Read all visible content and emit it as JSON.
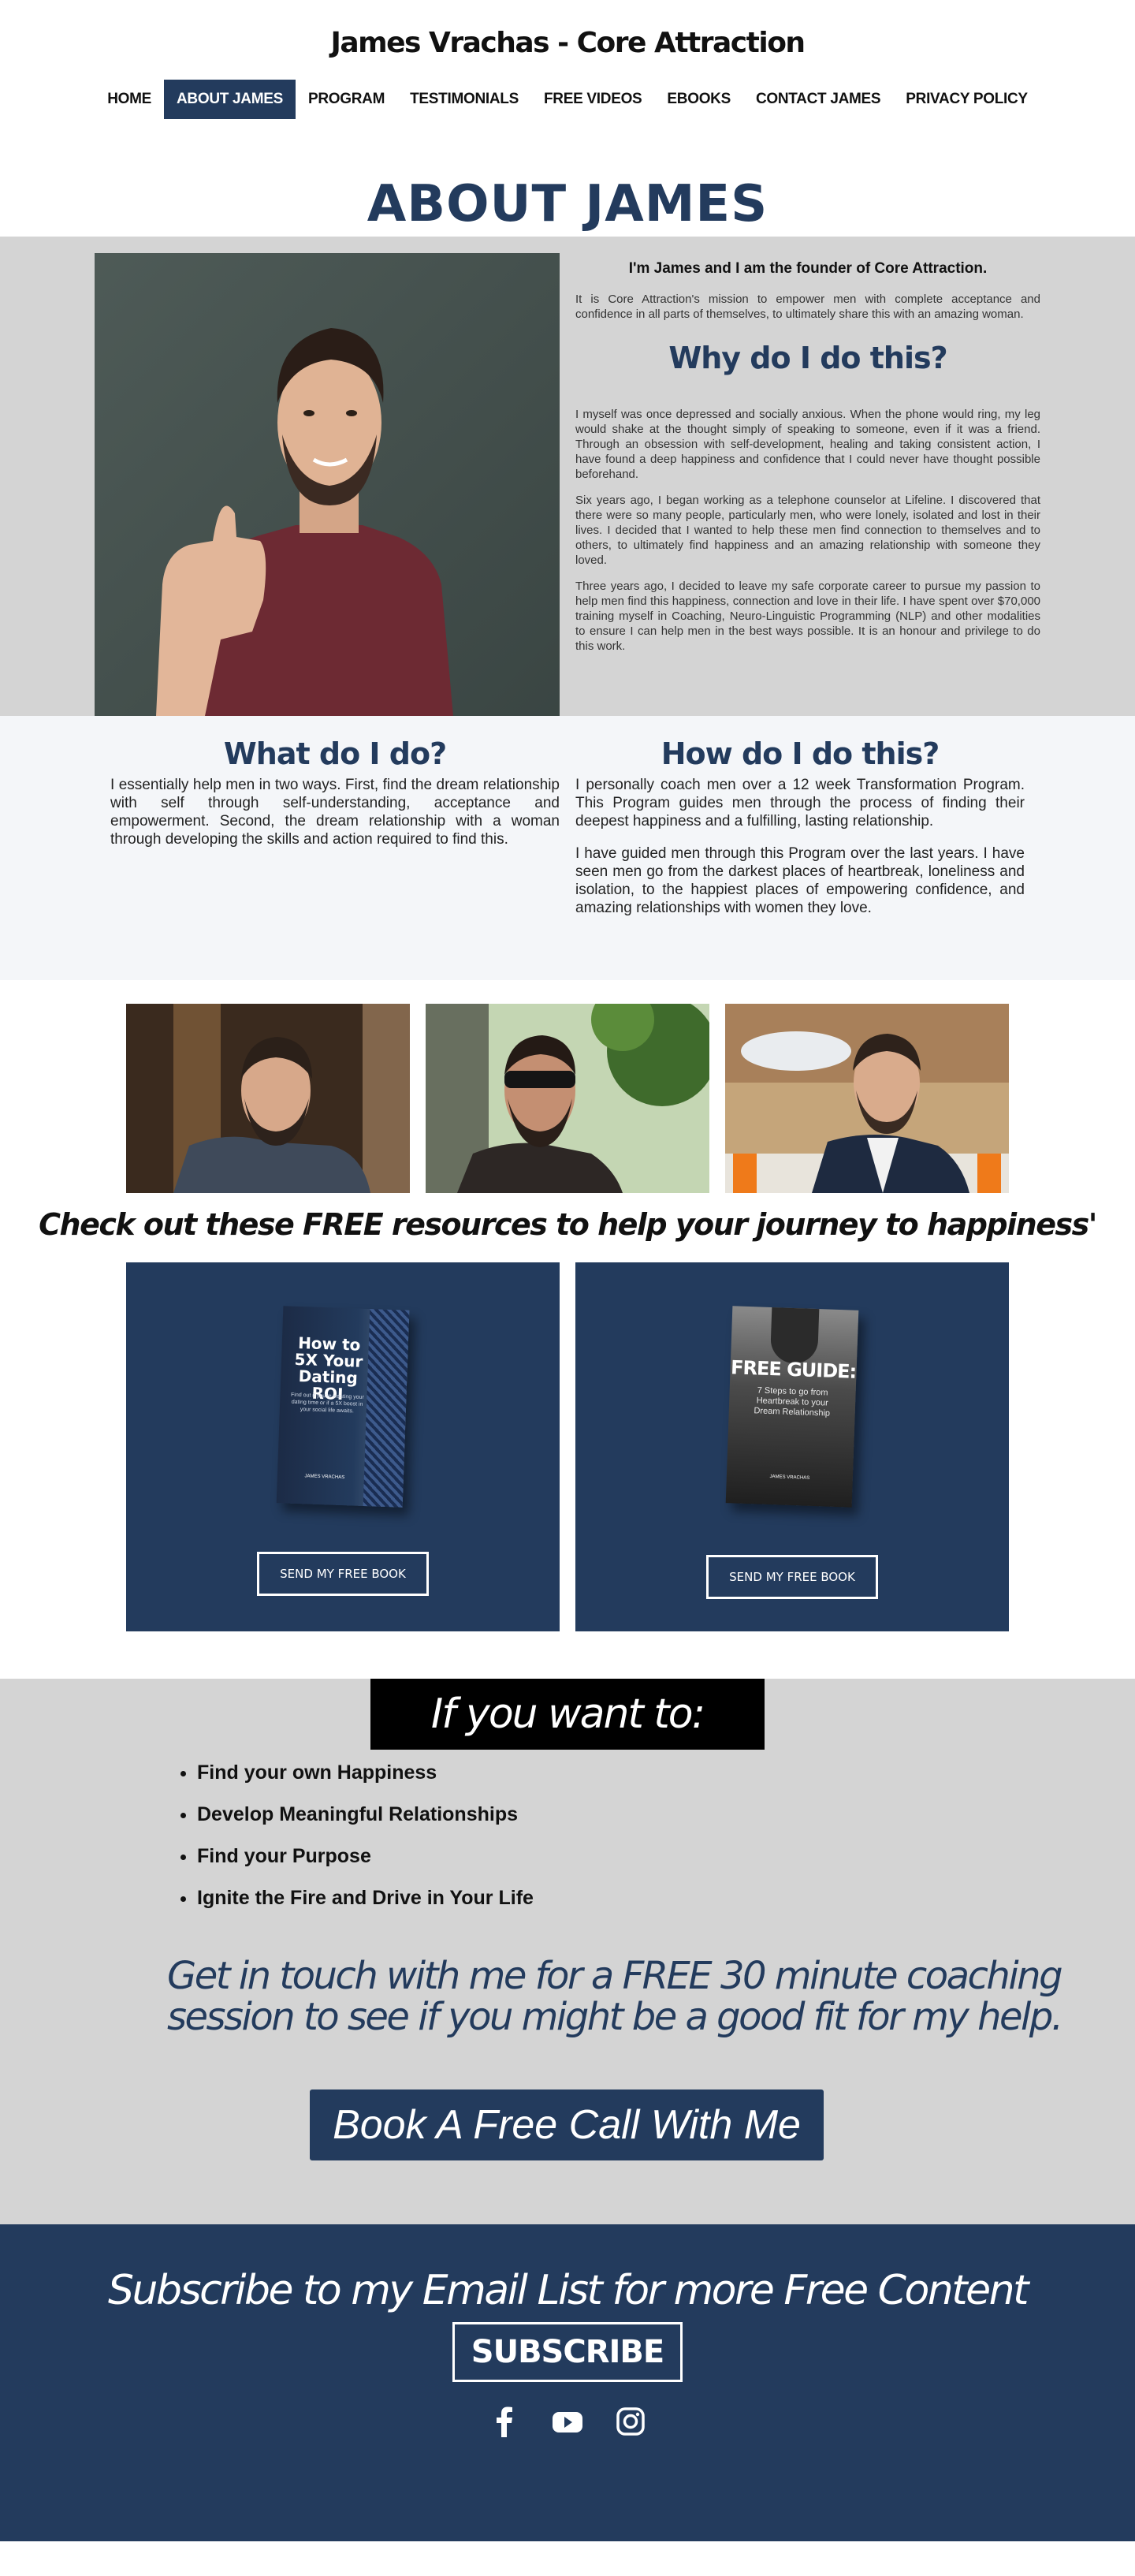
{
  "header": {
    "site_title": "James Vrachas - Core Attraction",
    "nav": [
      "HOME",
      "ABOUT JAMES",
      "PROGRAM",
      "TESTIMONIALS",
      "FREE VIDEOS",
      "EBOOKS",
      "CONTACT JAMES",
      "PRIVACY POLICY"
    ],
    "active_nav": "ABOUT JAMES"
  },
  "page_heading": "ABOUT JAMES",
  "about": {
    "intro": "I'm James and I am the founder of Core Attraction.",
    "mission": "It is Core Attraction's mission to empower men with complete acceptance and confidence in all parts of themselves, to ultimately share this with an amazing woman.",
    "why_heading": "Why do I do this?",
    "paragraphs": [
      "I myself was once depressed and socially anxious. When the phone would ring, my leg would shake at the thought simply of speaking to someone, even if it was a friend. Through an obsession with self-development, healing and taking consistent action, I have found a deep happiness and confidence that I could never have thought possible beforehand.",
      "Six years ago, I began working as a telephone counselor at Lifeline. I discovered that there were so many people, particularly men, who were lonely, isolated and lost in their lives. I decided that I wanted to help these men find connection to themselves and to others, to ultimately find happiness and an amazing relationship with someone they loved.",
      "Three years ago, I decided to leave my safe corporate career to pursue my passion to help men find this happiness, connection and love in their life. I have spent over $70,000 training myself in Coaching, Neuro-Linguistic Programming (NLP) and other modalities to ensure I can help men in the best ways possible. It is an honour and privilege to do this work."
    ]
  },
  "what": {
    "heading": "What do I do?",
    "text": "I essentially help men in two ways. First, find the dream relationship with self through self-understanding, acceptance and empowerment. Second, the dream relationship with a woman through developing the skills and action required to find this."
  },
  "how": {
    "heading": "How do I do this?",
    "paragraphs": [
      "I personally coach men over a 12 week Transformation Program. This Program guides men through the process of finding their deepest happiness and a fulfilling, lasting relationship.",
      "I have guided men through this Program over the last years. I have seen men go from the darkest places of heartbreak, loneliness and isolation, to the happiest places of empowering confidence, and amazing relationships with women they love."
    ]
  },
  "resources_heading": "Check out these FREE resources to help your journey to happiness'",
  "books": [
    {
      "cover_title": "How to 5X Your Dating ROI",
      "cover_sub": "Find out if you're wasting your dating time or if a 5X boost in your social life awaits.",
      "cover_author": "JAMES VRACHAS",
      "button": "SEND MY FREE BOOK"
    },
    {
      "cover_title": "FREE GUIDE:",
      "cover_sub": "7 Steps to go from Heartbreak to your Dream Relationship",
      "cover_author": "JAMES VRACHAS",
      "button": "SEND MY FREE BOOK"
    }
  ],
  "want": {
    "banner": "If you want to:",
    "items": [
      "Find your own Happiness",
      "Develop Meaningful Relationships",
      "Find your Purpose",
      "Ignite the Fire and Drive in Your Life"
    ],
    "cta_line1": "Get in touch with me for a FREE 30 minute coaching",
    "cta_line2": "session to see if you might be a good fit for my help.",
    "button": "Book A Free Call With Me"
  },
  "footer": {
    "subscribe_heading": "Subscribe to my Email List for more Free Content",
    "subscribe_button": "SUBSCRIBE",
    "socials": [
      "facebook-icon",
      "youtube-icon",
      "instagram-icon"
    ]
  },
  "colors": {
    "brand_navy": "#233b5d",
    "section_gray": "#d4d4d4",
    "light_section": "#f4f6f9"
  }
}
